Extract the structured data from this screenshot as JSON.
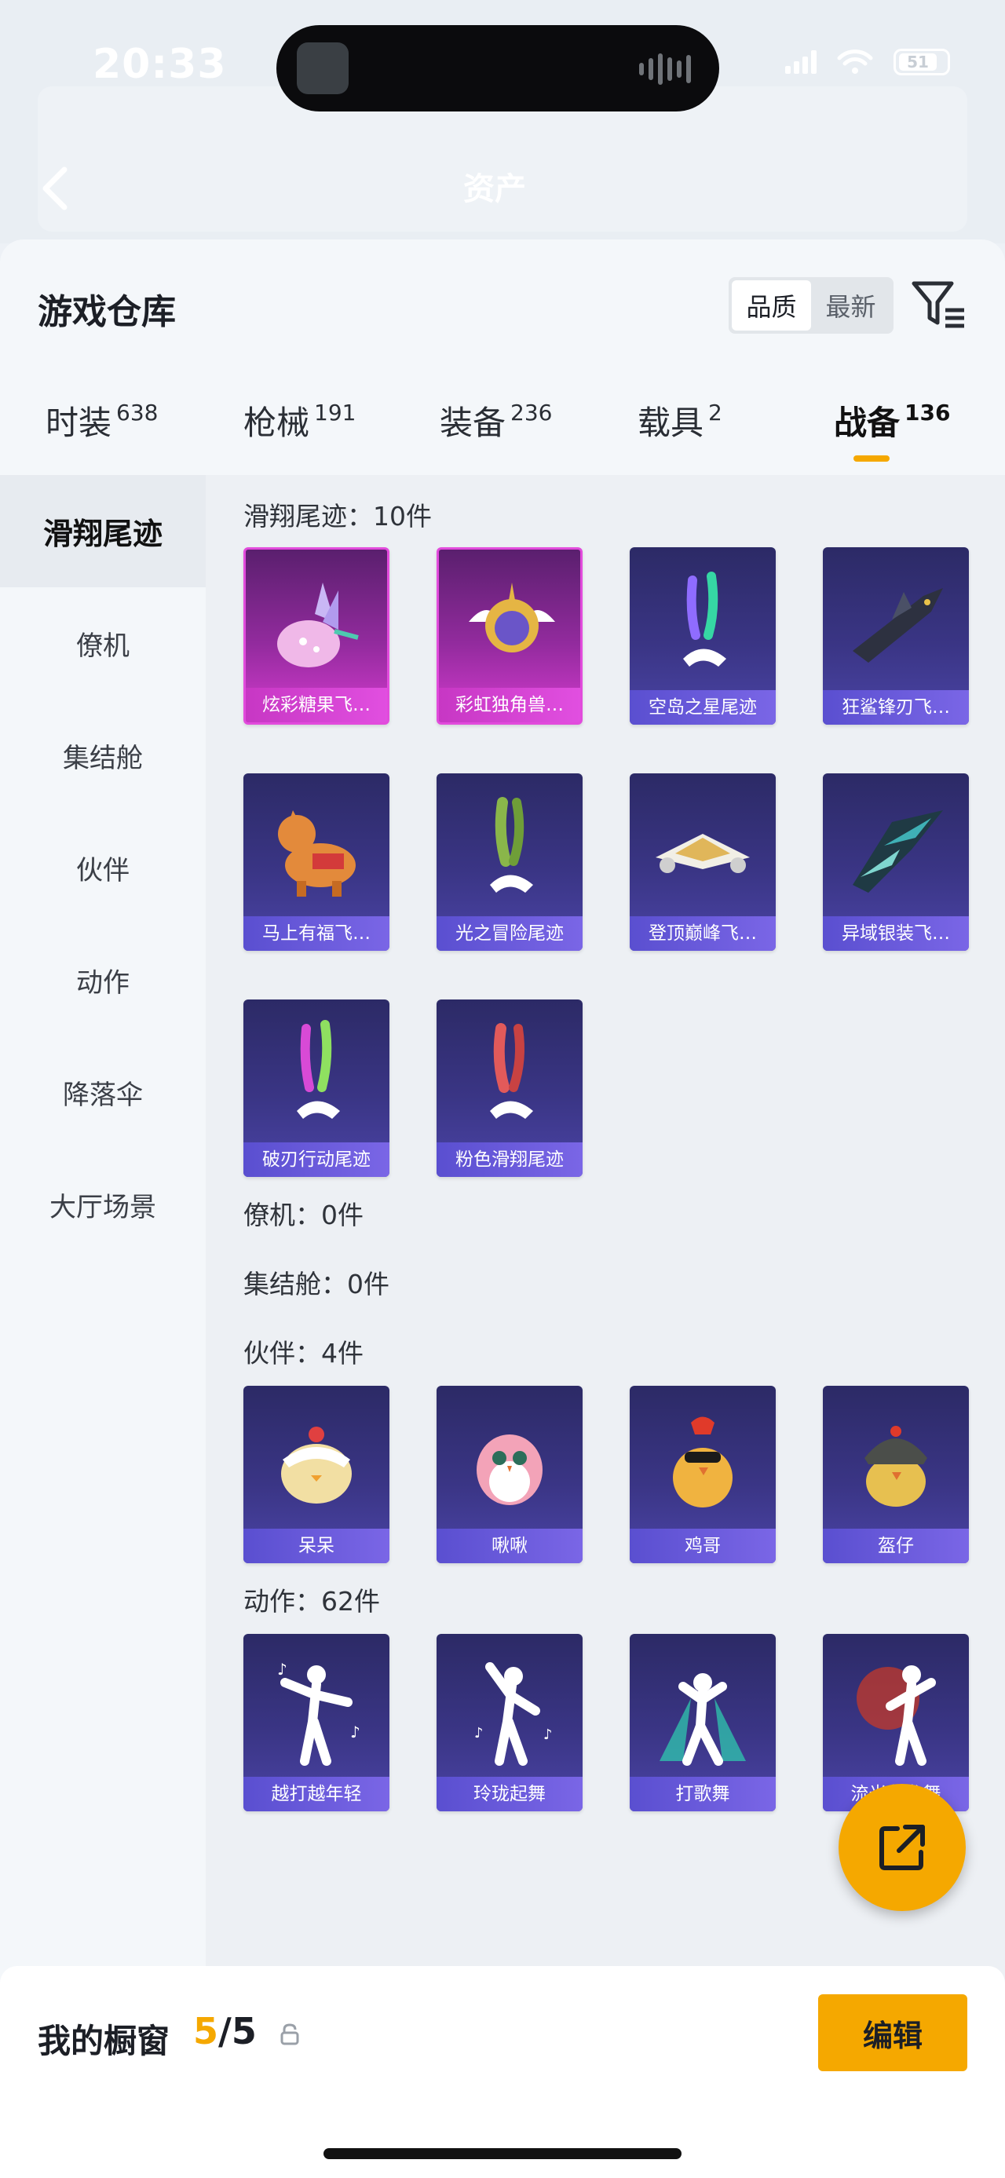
{
  "status_bar": {
    "time": "20:33",
    "battery": "51"
  },
  "nav": {
    "title": "资产"
  },
  "sheet": {
    "title": "游戏仓库",
    "sort_options": [
      "品质",
      "最新"
    ],
    "sort_active": "品质"
  },
  "tabs": [
    {
      "label": "时装",
      "count": "638"
    },
    {
      "label": "枪械",
      "count": "191"
    },
    {
      "label": "装备",
      "count": "236"
    },
    {
      "label": "载具",
      "count": "2"
    },
    {
      "label": "战备",
      "count": "136",
      "active": true
    }
  ],
  "left_nav": [
    "滑翔尾迹",
    "僚机",
    "集结舱",
    "伙伴",
    "动作",
    "降落伞",
    "大厅场景"
  ],
  "sections": {
    "glide": {
      "label": "滑翔尾迹：10件",
      "items": [
        "炫彩糖果飞…",
        "彩虹独角兽…",
        "空岛之星尾迹",
        "狂鲨锋刃飞…",
        "马上有福飞…",
        "光之冒险尾迹",
        "登顶巅峰飞…",
        "异域银装飞…",
        "破刃行动尾迹",
        "粉色滑翔尾迹"
      ]
    },
    "wingman": {
      "label": "僚机：0件"
    },
    "pod": {
      "label": "集结舱：0件"
    },
    "partner": {
      "label": "伙伴：4件",
      "items": [
        "呆呆",
        "啾啾",
        "鸡哥",
        "盔仔"
      ]
    },
    "emote": {
      "label": "动作：62件",
      "items": [
        "越打越年轻",
        "玲珑起舞",
        "打歌舞",
        "流光鱼龙舞"
      ]
    }
  },
  "bottom_bar": {
    "label": "我的橱窗",
    "count_current": "5",
    "count_total": "/5",
    "edit_label": "编辑"
  },
  "colors": {
    "accent": "#f5a800",
    "card_purple": "#3a3585",
    "card_pink": "#d53bcf"
  }
}
